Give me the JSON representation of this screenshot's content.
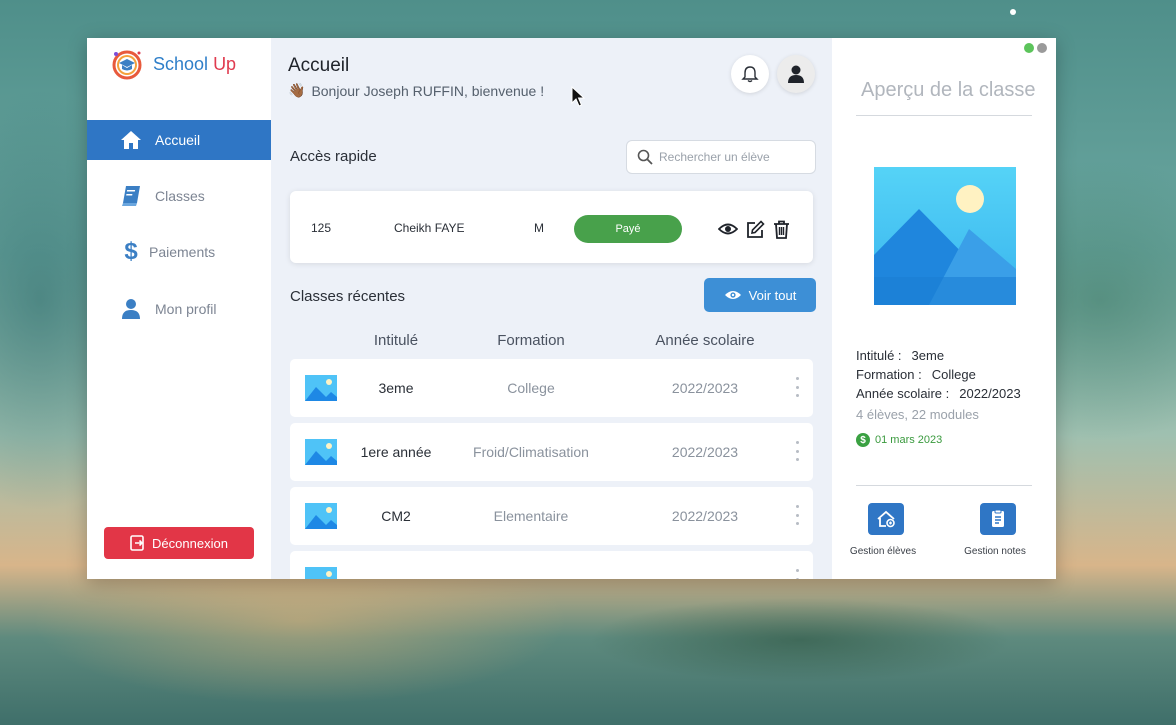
{
  "app": {
    "logo_school": "School",
    "logo_up": "Up"
  },
  "sidebar": {
    "items": [
      {
        "label": "Accueil",
        "icon": "home-icon",
        "active": true
      },
      {
        "label": "Classes",
        "icon": "book-icon",
        "active": false
      },
      {
        "label": "Paiements",
        "icon": "dollar-icon",
        "active": false
      },
      {
        "label": "Mon profil",
        "icon": "user-icon",
        "active": false
      }
    ],
    "logout_label": "Déconnexion"
  },
  "header": {
    "title": "Accueil",
    "welcome": "Bonjour Joseph RUFFIN, bienvenue !"
  },
  "quick_access": {
    "title": "Accès rapide",
    "search_placeholder": "Rechercher un élève",
    "student": {
      "id": "125",
      "name": "Cheikh FAYE",
      "gender": "M",
      "status": "Payé"
    }
  },
  "recent": {
    "title": "Classes récentes",
    "view_all_label": "Voir tout",
    "columns": [
      "Intitulé",
      "Formation",
      "Année scolaire"
    ],
    "rows": [
      {
        "name": "3eme",
        "formation": "College",
        "year": "2022/2023"
      },
      {
        "name": "1ere année",
        "formation": "Froid/Climatisation",
        "year": "2022/2023"
      },
      {
        "name": "CM2",
        "formation": "Elementaire",
        "year": "2022/2023"
      }
    ]
  },
  "overview": {
    "title": "Aperçu de la classe",
    "intitule_label": "Intitulé :",
    "intitule_value": "3eme",
    "formation_label": "Formation :",
    "formation_value": "College",
    "annee_label": "Année scolaire :",
    "annee_value": "2022/2023",
    "summary": "4 élèves, 22 modules",
    "payment_date": "01 mars 2023",
    "actions": [
      {
        "label": "Gestion élèves",
        "icon": "manage-students-icon"
      },
      {
        "label": "Gestion notes",
        "icon": "manage-grades-icon"
      }
    ]
  },
  "colors": {
    "primary": "#2f76c5",
    "danger": "#e23647",
    "success": "#48a14b",
    "accent": "#3d8fd6"
  }
}
